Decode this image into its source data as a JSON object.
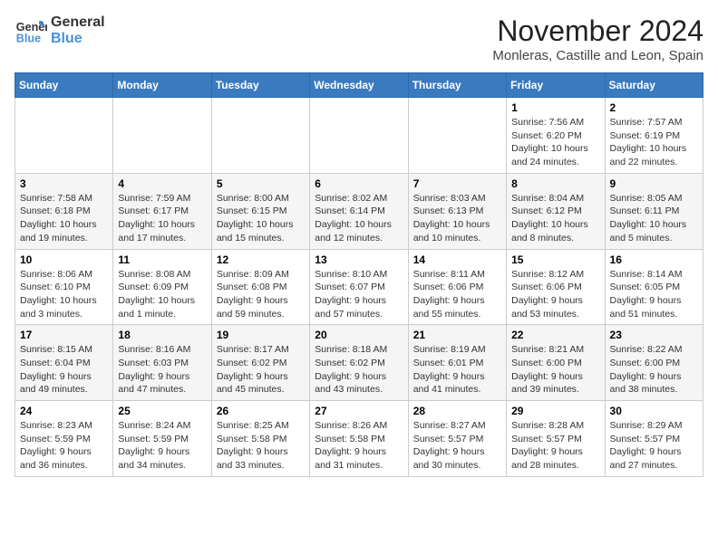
{
  "logo": {
    "line1": "General",
    "line2": "Blue"
  },
  "title": "November 2024",
  "location": "Monleras, Castille and Leon, Spain",
  "headers": [
    "Sunday",
    "Monday",
    "Tuesday",
    "Wednesday",
    "Thursday",
    "Friday",
    "Saturday"
  ],
  "weeks": [
    [
      {
        "day": "",
        "info": ""
      },
      {
        "day": "",
        "info": ""
      },
      {
        "day": "",
        "info": ""
      },
      {
        "day": "",
        "info": ""
      },
      {
        "day": "",
        "info": ""
      },
      {
        "day": "1",
        "info": "Sunrise: 7:56 AM\nSunset: 6:20 PM\nDaylight: 10 hours and 24 minutes."
      },
      {
        "day": "2",
        "info": "Sunrise: 7:57 AM\nSunset: 6:19 PM\nDaylight: 10 hours and 22 minutes."
      }
    ],
    [
      {
        "day": "3",
        "info": "Sunrise: 7:58 AM\nSunset: 6:18 PM\nDaylight: 10 hours and 19 minutes."
      },
      {
        "day": "4",
        "info": "Sunrise: 7:59 AM\nSunset: 6:17 PM\nDaylight: 10 hours and 17 minutes."
      },
      {
        "day": "5",
        "info": "Sunrise: 8:00 AM\nSunset: 6:15 PM\nDaylight: 10 hours and 15 minutes."
      },
      {
        "day": "6",
        "info": "Sunrise: 8:02 AM\nSunset: 6:14 PM\nDaylight: 10 hours and 12 minutes."
      },
      {
        "day": "7",
        "info": "Sunrise: 8:03 AM\nSunset: 6:13 PM\nDaylight: 10 hours and 10 minutes."
      },
      {
        "day": "8",
        "info": "Sunrise: 8:04 AM\nSunset: 6:12 PM\nDaylight: 10 hours and 8 minutes."
      },
      {
        "day": "9",
        "info": "Sunrise: 8:05 AM\nSunset: 6:11 PM\nDaylight: 10 hours and 5 minutes."
      }
    ],
    [
      {
        "day": "10",
        "info": "Sunrise: 8:06 AM\nSunset: 6:10 PM\nDaylight: 10 hours and 3 minutes."
      },
      {
        "day": "11",
        "info": "Sunrise: 8:08 AM\nSunset: 6:09 PM\nDaylight: 10 hours and 1 minute."
      },
      {
        "day": "12",
        "info": "Sunrise: 8:09 AM\nSunset: 6:08 PM\nDaylight: 9 hours and 59 minutes."
      },
      {
        "day": "13",
        "info": "Sunrise: 8:10 AM\nSunset: 6:07 PM\nDaylight: 9 hours and 57 minutes."
      },
      {
        "day": "14",
        "info": "Sunrise: 8:11 AM\nSunset: 6:06 PM\nDaylight: 9 hours and 55 minutes."
      },
      {
        "day": "15",
        "info": "Sunrise: 8:12 AM\nSunset: 6:06 PM\nDaylight: 9 hours and 53 minutes."
      },
      {
        "day": "16",
        "info": "Sunrise: 8:14 AM\nSunset: 6:05 PM\nDaylight: 9 hours and 51 minutes."
      }
    ],
    [
      {
        "day": "17",
        "info": "Sunrise: 8:15 AM\nSunset: 6:04 PM\nDaylight: 9 hours and 49 minutes."
      },
      {
        "day": "18",
        "info": "Sunrise: 8:16 AM\nSunset: 6:03 PM\nDaylight: 9 hours and 47 minutes."
      },
      {
        "day": "19",
        "info": "Sunrise: 8:17 AM\nSunset: 6:02 PM\nDaylight: 9 hours and 45 minutes."
      },
      {
        "day": "20",
        "info": "Sunrise: 8:18 AM\nSunset: 6:02 PM\nDaylight: 9 hours and 43 minutes."
      },
      {
        "day": "21",
        "info": "Sunrise: 8:19 AM\nSunset: 6:01 PM\nDaylight: 9 hours and 41 minutes."
      },
      {
        "day": "22",
        "info": "Sunrise: 8:21 AM\nSunset: 6:00 PM\nDaylight: 9 hours and 39 minutes."
      },
      {
        "day": "23",
        "info": "Sunrise: 8:22 AM\nSunset: 6:00 PM\nDaylight: 9 hours and 38 minutes."
      }
    ],
    [
      {
        "day": "24",
        "info": "Sunrise: 8:23 AM\nSunset: 5:59 PM\nDaylight: 9 hours and 36 minutes."
      },
      {
        "day": "25",
        "info": "Sunrise: 8:24 AM\nSunset: 5:59 PM\nDaylight: 9 hours and 34 minutes."
      },
      {
        "day": "26",
        "info": "Sunrise: 8:25 AM\nSunset: 5:58 PM\nDaylight: 9 hours and 33 minutes."
      },
      {
        "day": "27",
        "info": "Sunrise: 8:26 AM\nSunset: 5:58 PM\nDaylight: 9 hours and 31 minutes."
      },
      {
        "day": "28",
        "info": "Sunrise: 8:27 AM\nSunset: 5:57 PM\nDaylight: 9 hours and 30 minutes."
      },
      {
        "day": "29",
        "info": "Sunrise: 8:28 AM\nSunset: 5:57 PM\nDaylight: 9 hours and 28 minutes."
      },
      {
        "day": "30",
        "info": "Sunrise: 8:29 AM\nSunset: 5:57 PM\nDaylight: 9 hours and 27 minutes."
      }
    ]
  ]
}
